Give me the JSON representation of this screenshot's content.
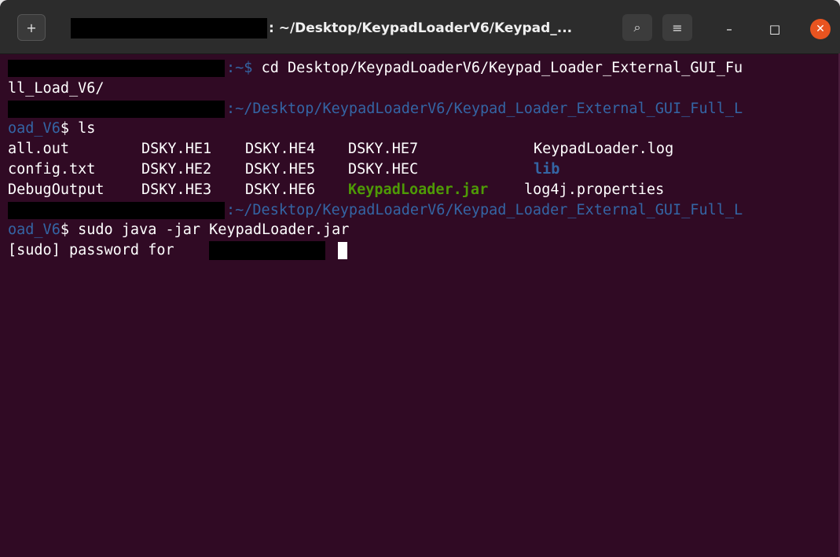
{
  "window": {
    "title": ": ~/Desktop/KeypadLoaderV6/Keypad_...",
    "new_tab_icon": "+",
    "search_icon": "⌕",
    "menu_icon": "≡",
    "minimize_icon": "–",
    "maximize_icon": "□",
    "close_icon": "✕"
  },
  "colors": {
    "background": "#300a24",
    "path": "#3465a4",
    "executable": "#4e9a06",
    "close_button": "#e95420"
  },
  "terminal": {
    "line1_prompt_tail": ":~$ ",
    "line1_cmd": "cd Desktop/KeypadLoaderV6/Keypad_Loader_External_GUI_Fu",
    "line2": "ll_Load_V6/",
    "line3_prompt_path": ":~/Desktop/KeypadLoaderV6/Keypad_Loader_External_GUI_Full_L",
    "line4_path": "oad_V6",
    "line4_cmd": "$ ls",
    "ls": {
      "row1": [
        "all.out",
        "DSKY.HE1",
        "DSKY.HE4",
        "DSKY.HE7",
        "KeypadLoader.log"
      ],
      "row2": [
        "config.txt",
        "DSKY.HE2",
        "DSKY.HE5",
        "DSKY.HEC",
        "lib"
      ],
      "row3": [
        "DebugOutput",
        "DSKY.HE3",
        "DSKY.HE6",
        "KeypadLoader.jar",
        "log4j.properties"
      ]
    },
    "line8_prompt_path": ":~/Desktop/KeypadLoaderV6/Keypad_Loader_External_GUI_Full_L",
    "line9_path": "oad_V6",
    "line9_cmd": "$ sudo java -jar KeypadLoader.jar",
    "line10": "[sudo] password for "
  }
}
